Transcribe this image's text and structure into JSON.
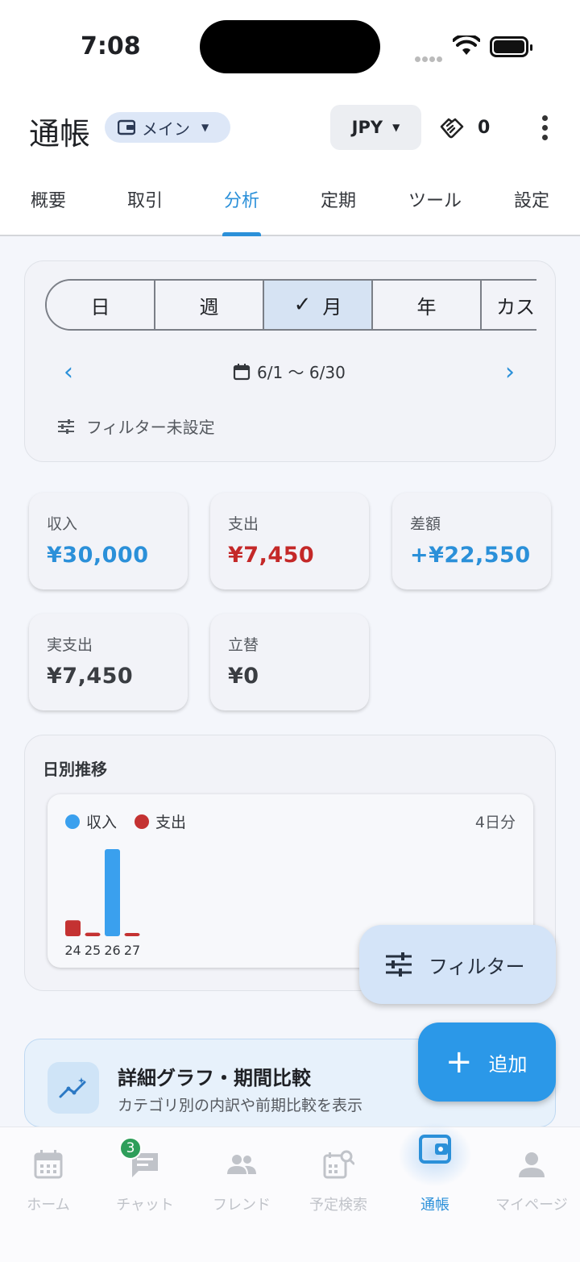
{
  "status_bar": {
    "time": "7:08"
  },
  "app_bar": {
    "title": "通帳",
    "wallet_label": "メイン",
    "currency": "JPY",
    "points": "0"
  },
  "tabs": [
    {
      "label": "概要"
    },
    {
      "label": "取引"
    },
    {
      "label": "分析",
      "active": true
    },
    {
      "label": "定期"
    },
    {
      "label": "ツール"
    },
    {
      "label": "設定"
    }
  ],
  "period": {
    "segments": [
      {
        "label": "日"
      },
      {
        "label": "週"
      },
      {
        "label": "月",
        "active": true
      },
      {
        "label": "年"
      },
      {
        "label": "カスタム"
      }
    ],
    "range": "6/1 〜 6/30",
    "filter_status": "フィルター未設定"
  },
  "summary": {
    "income": {
      "label": "収入",
      "value": "¥30,000",
      "color": "#2b90d9"
    },
    "expense": {
      "label": "支出",
      "value": "¥7,450",
      "color": "#c42828"
    },
    "difference": {
      "label": "差額",
      "value": "+¥22,550",
      "color": "#2b90d9"
    },
    "actual_expense": {
      "label": "実支出",
      "value": "¥7,450",
      "color": "#3a3d42"
    },
    "advance": {
      "label": "立替",
      "value": "¥0",
      "color": "#3a3d42"
    }
  },
  "daily_trend": {
    "title": "日別推移",
    "legend_income": "収入",
    "legend_expense": "支出",
    "days_count": "4日分",
    "colors": {
      "income": "#3aa0ee",
      "expense": "#c43232"
    }
  },
  "chart_data": {
    "type": "bar",
    "categories": [
      "24",
      "25",
      "26",
      "27"
    ],
    "series": [
      {
        "name": "収入",
        "values": [
          0,
          0,
          30000,
          0
        ]
      },
      {
        "name": "支出",
        "values": [
          5500,
          1200,
          0,
          750
        ]
      }
    ],
    "legend": "top-left",
    "grid": false
  },
  "detail_card": {
    "title": "詳細グラフ・期間比較",
    "subtitle": "カテゴリ別の内訳や前期比較を表示"
  },
  "fab": {
    "filter_label": "フィルター",
    "add_label": "追加"
  },
  "bottom_nav": [
    {
      "label": "ホーム",
      "icon": "calendar-icon"
    },
    {
      "label": "チャット",
      "icon": "chat-icon",
      "badge": "3"
    },
    {
      "label": "フレンド",
      "icon": "people-icon"
    },
    {
      "label": "予定検索",
      "icon": "calendar-search-icon"
    },
    {
      "label": "通帳",
      "icon": "wallet-icon",
      "active": true
    },
    {
      "label": "マイページ",
      "icon": "person-icon"
    }
  ]
}
